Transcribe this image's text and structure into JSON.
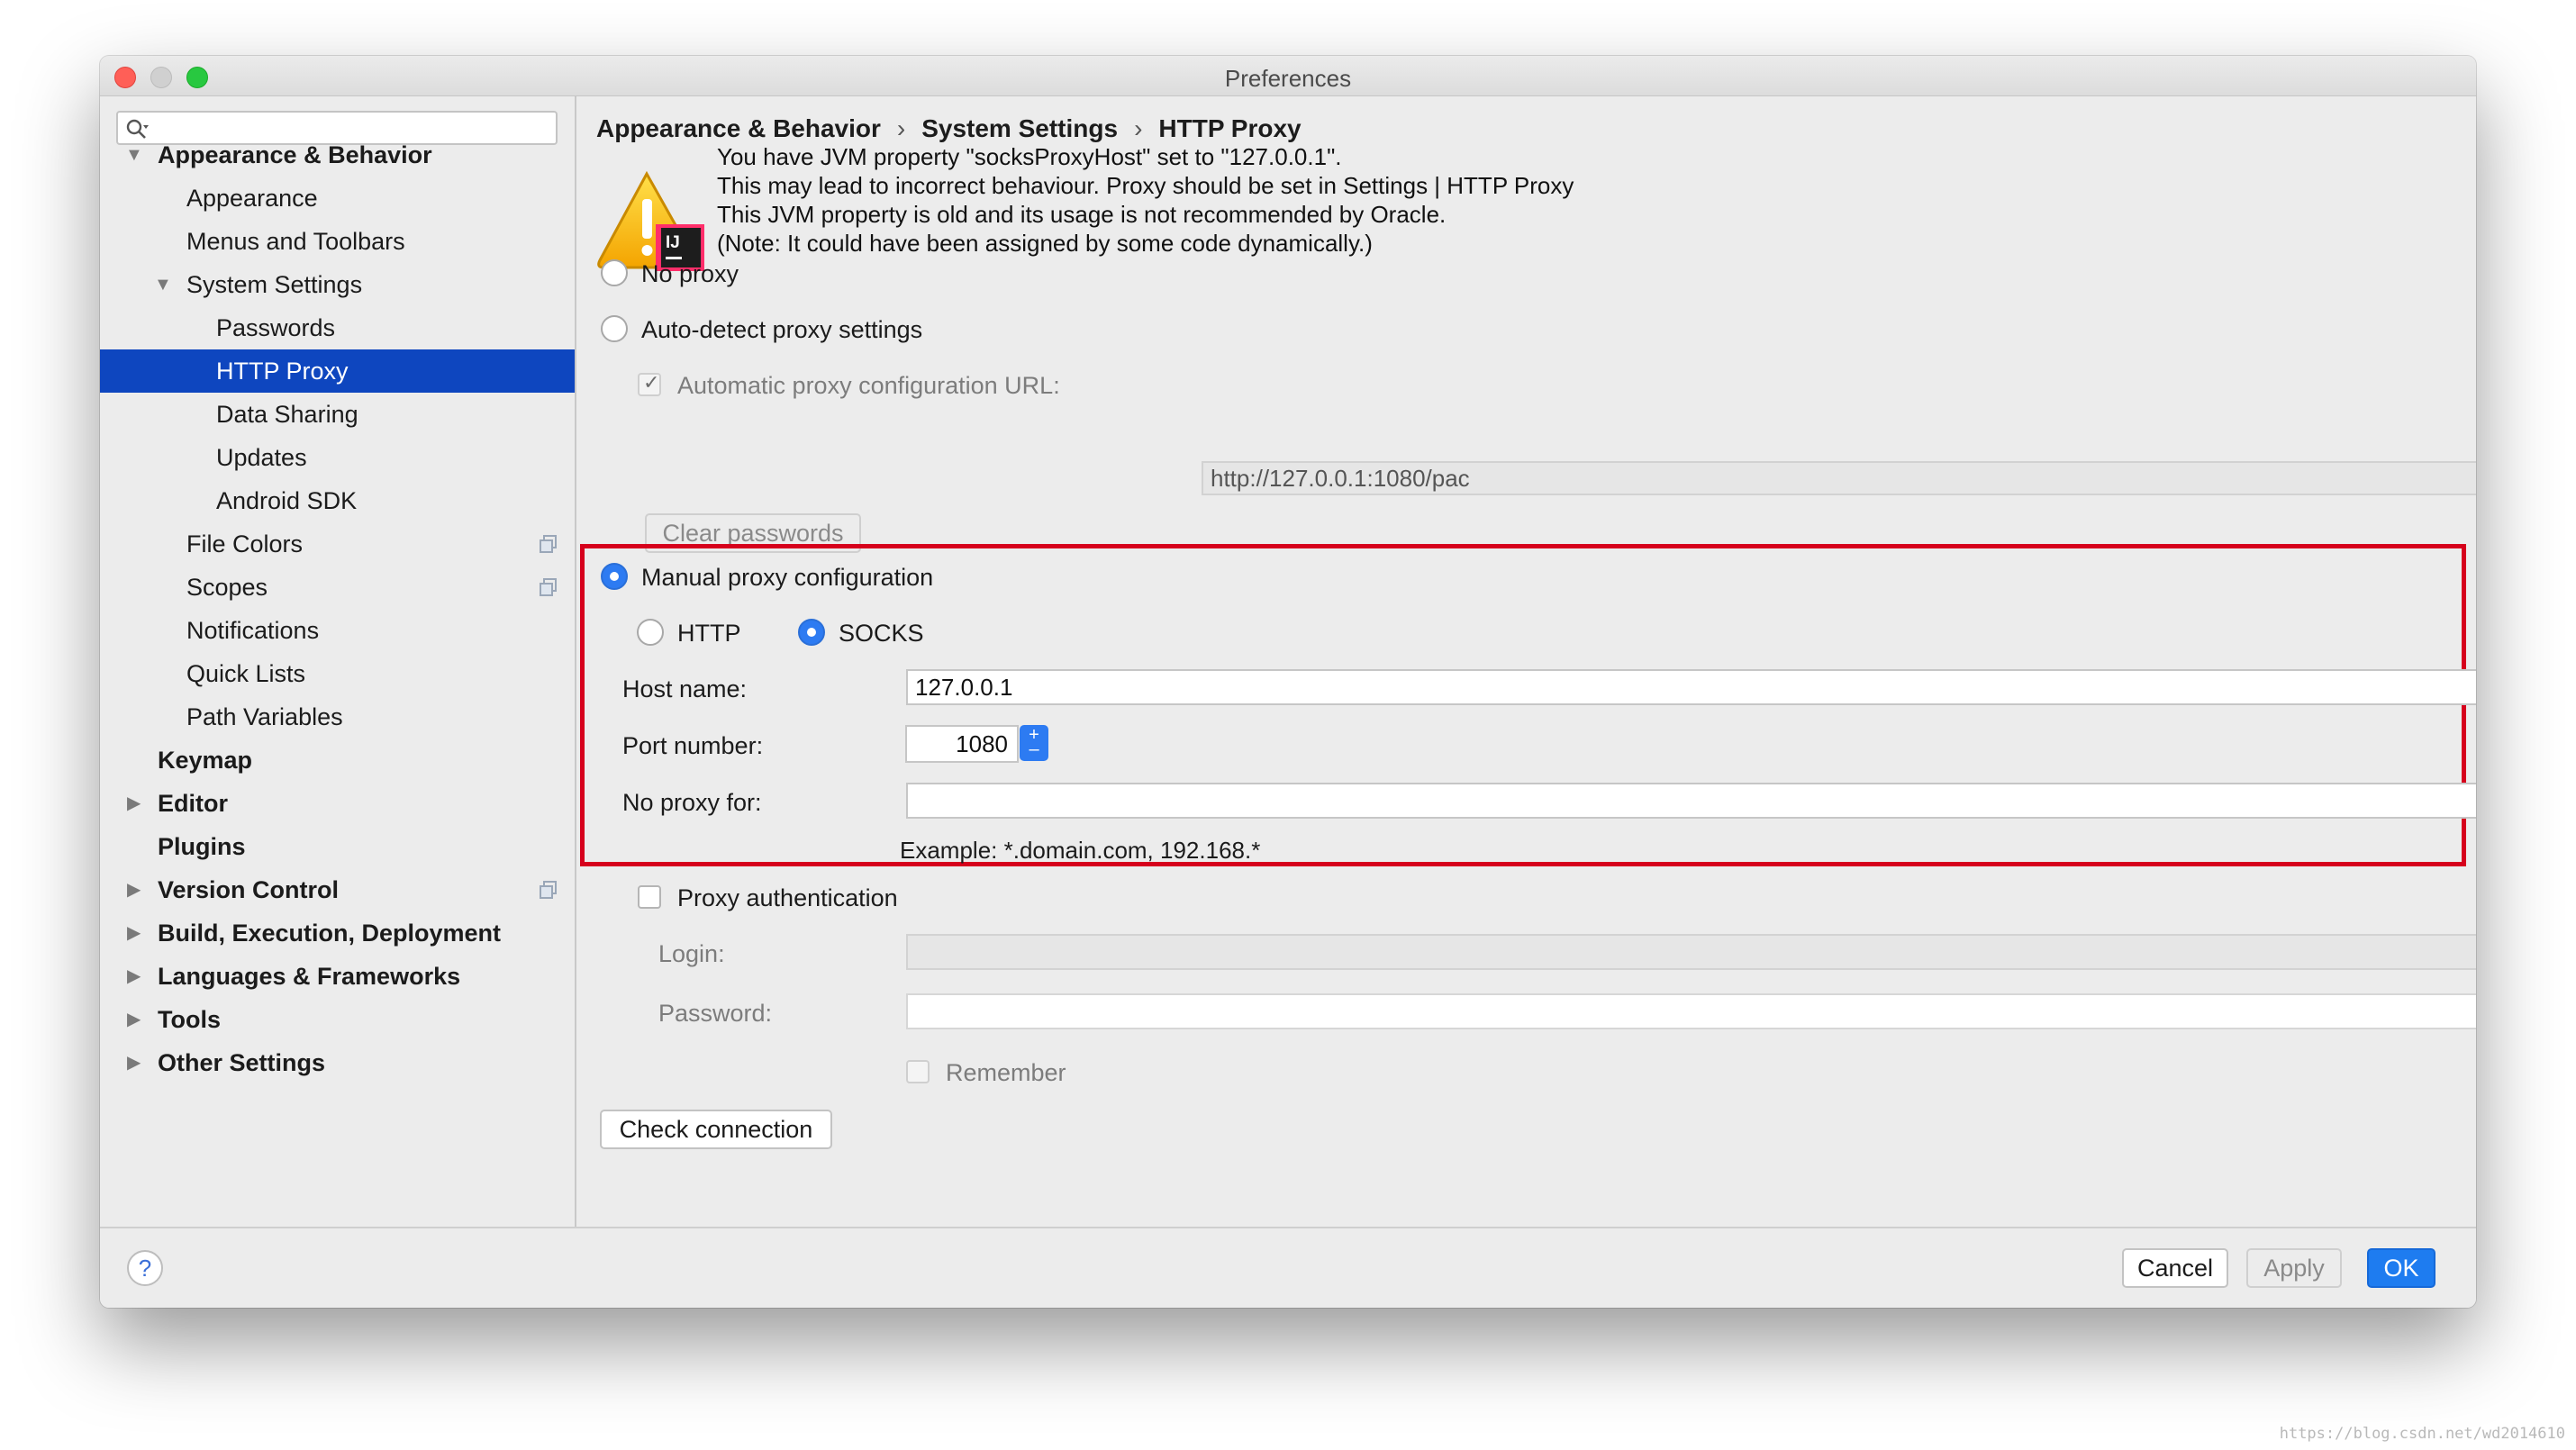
{
  "window": {
    "title": "Preferences"
  },
  "search": {
    "placeholder": ""
  },
  "sidebar": {
    "items": [
      {
        "label": "Appearance & Behavior",
        "expanded": true
      },
      {
        "label": "Appearance"
      },
      {
        "label": "Menus and Toolbars"
      },
      {
        "label": "System Settings",
        "expanded": true
      },
      {
        "label": "Passwords"
      },
      {
        "label": "HTTP Proxy",
        "selected": true
      },
      {
        "label": "Data Sharing"
      },
      {
        "label": "Updates"
      },
      {
        "label": "Android SDK"
      },
      {
        "label": "File Colors",
        "icon": "copy-icon"
      },
      {
        "label": "Scopes",
        "icon": "copy-icon"
      },
      {
        "label": "Notifications"
      },
      {
        "label": "Quick Lists"
      },
      {
        "label": "Path Variables"
      },
      {
        "label": "Keymap"
      },
      {
        "label": "Editor",
        "expanded": false
      },
      {
        "label": "Plugins"
      },
      {
        "label": "Version Control",
        "expanded": false,
        "icon": "copy-icon"
      },
      {
        "label": "Build, Execution, Deployment",
        "expanded": false
      },
      {
        "label": "Languages & Frameworks",
        "expanded": false
      },
      {
        "label": "Tools",
        "expanded": false
      },
      {
        "label": "Other Settings",
        "expanded": false
      }
    ]
  },
  "breadcrumb": [
    "Appearance & Behavior",
    "System Settings",
    "HTTP Proxy"
  ],
  "breadcrumb_separator": "›",
  "warning": {
    "icon": "warning-intellij-icon",
    "lines": [
      "You have JVM property \"socksProxyHost\" set to \"127.0.0.1\".",
      "This may lead to incorrect behaviour. Proxy should be set in Settings | HTTP Proxy",
      "This JVM property is old and its usage is not recommended by Oracle.",
      "(Note: It could have been assigned by some code dynamically.)"
    ]
  },
  "proxy": {
    "no_proxy_label": "No proxy",
    "auto_detect_label": "Auto-detect proxy settings",
    "auto_config_url_label": "Automatic proxy configuration URL:",
    "auto_config_url_value": "http://127.0.0.1:1080/pac",
    "auto_config_url_checked": true,
    "clear_passwords_label": "Clear passwords",
    "manual_label": "Manual proxy configuration",
    "selected_mode": "manual",
    "http_label": "HTTP",
    "socks_label": "SOCKS",
    "selected_type": "SOCKS",
    "host_label": "Host name:",
    "host_value": "127.0.0.1",
    "port_label": "Port number:",
    "port_value": "1080",
    "no_proxy_for_label": "No proxy for:",
    "no_proxy_for_value": "",
    "example_text": "Example: *.domain.com, 192.168.*",
    "auth_label": "Proxy authentication",
    "auth_checked": false,
    "login_label": "Login:",
    "login_value": "",
    "password_label": "Password:",
    "password_value": "",
    "remember_label": "Remember",
    "remember_checked": false,
    "check_connection_label": "Check connection"
  },
  "footer": {
    "help_label": "?",
    "cancel_label": "Cancel",
    "apply_label": "Apply",
    "ok_label": "OK"
  },
  "colors": {
    "selection": "#0e46bf",
    "accent": "#2d7bf2",
    "highlight_border": "#d6001c"
  },
  "watermark": "https://blog.csdn.net/wd2014610"
}
